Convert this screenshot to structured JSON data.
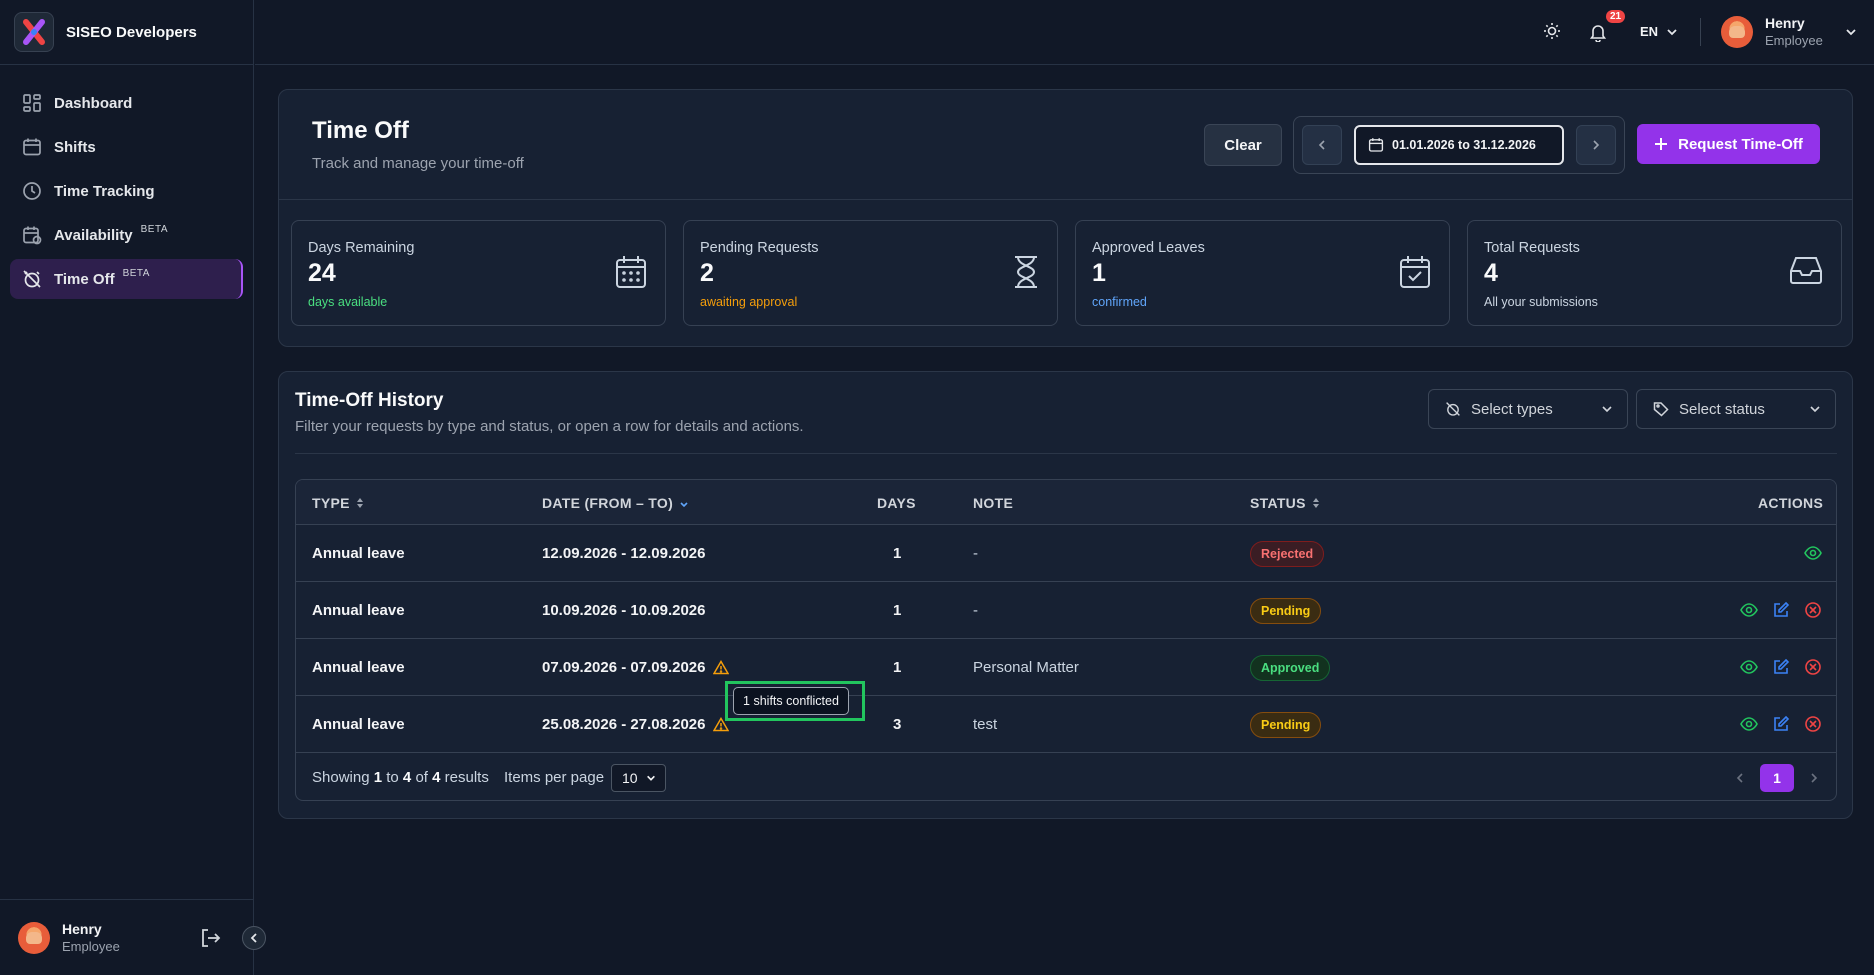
{
  "brand": {
    "name": "SISEO Developers"
  },
  "sidebar": {
    "items": [
      {
        "label": "Dashboard",
        "icon": "dashboard-icon"
      },
      {
        "label": "Shifts",
        "icon": "calendar-icon"
      },
      {
        "label": "Time Tracking",
        "icon": "clock-icon"
      },
      {
        "label": "Availability",
        "icon": "calendar-clock-icon",
        "badge": "BETA"
      },
      {
        "label": "Time Off",
        "icon": "alarm-off-icon",
        "badge": "BETA",
        "active": true
      }
    ],
    "user": {
      "name": "Henry",
      "role": "Employee"
    }
  },
  "topbar": {
    "notifications": "21",
    "language": "EN",
    "user": {
      "name": "Henry",
      "role": "Employee"
    }
  },
  "header": {
    "title": "Time Off",
    "subtitle": "Track and manage your time-off",
    "clear_label": "Clear",
    "date_range": "01.01.2026 to 31.12.2026",
    "request_label": "Request Time-Off"
  },
  "stats": [
    {
      "label": "Days Remaining",
      "value": "24",
      "note": "days available",
      "note_color": "#4ade80",
      "icon": "calendar-grid-icon"
    },
    {
      "label": "Pending Requests",
      "value": "2",
      "note": "awaiting approval",
      "note_color": "#f59e0b",
      "icon": "hourglass-icon"
    },
    {
      "label": "Approved Leaves",
      "value": "1",
      "note": "confirmed",
      "note_color": "#60a5fa",
      "icon": "calendar-check-icon"
    },
    {
      "label": "Total Requests",
      "value": "4",
      "note": "All your submissions",
      "note_color": "#cbd5e1",
      "icon": "inbox-icon"
    }
  ],
  "history": {
    "title": "Time-Off History",
    "subtitle": "Filter your requests by type and status, or open a row for details and actions.",
    "filter_type_placeholder": "Select types",
    "filter_status_placeholder": "Select status",
    "columns": {
      "type": "TYPE",
      "date": "DATE (FROM – TO)",
      "days": "DAYS",
      "note": "NOTE",
      "status": "STATUS",
      "actions": "ACTIONS"
    },
    "rows": [
      {
        "type": "Annual leave",
        "date": "12.09.2026 - 12.09.2026",
        "days": "1",
        "note": "-",
        "status": "Rejected",
        "status_key": "rejected",
        "conflict": false,
        "editable": false
      },
      {
        "type": "Annual leave",
        "date": "10.09.2026 - 10.09.2026",
        "days": "1",
        "note": "-",
        "status": "Pending",
        "status_key": "pending",
        "conflict": false,
        "editable": true
      },
      {
        "type": "Annual leave",
        "date": "07.09.2026 - 07.09.2026",
        "days": "1",
        "note": "Personal Matter",
        "status": "Approved",
        "status_key": "approved",
        "conflict": true,
        "editable": true
      },
      {
        "type": "Annual leave",
        "date": "25.08.2026 - 27.08.2026",
        "days": "3",
        "note": "test",
        "status": "Pending",
        "status_key": "pending",
        "conflict": true,
        "editable": true
      }
    ],
    "tooltip": "1 shifts conflicted",
    "footer": {
      "showing": "Showing",
      "from": "1",
      "to_word": "to",
      "to": "4",
      "of_word": "of",
      "total": "4",
      "results": "results",
      "items_per_page": "Items per page",
      "per_page_value": "10",
      "current_page": "1"
    }
  },
  "colors": {
    "accent": "#9333ea",
    "background": "#111827",
    "card": "#172133"
  }
}
